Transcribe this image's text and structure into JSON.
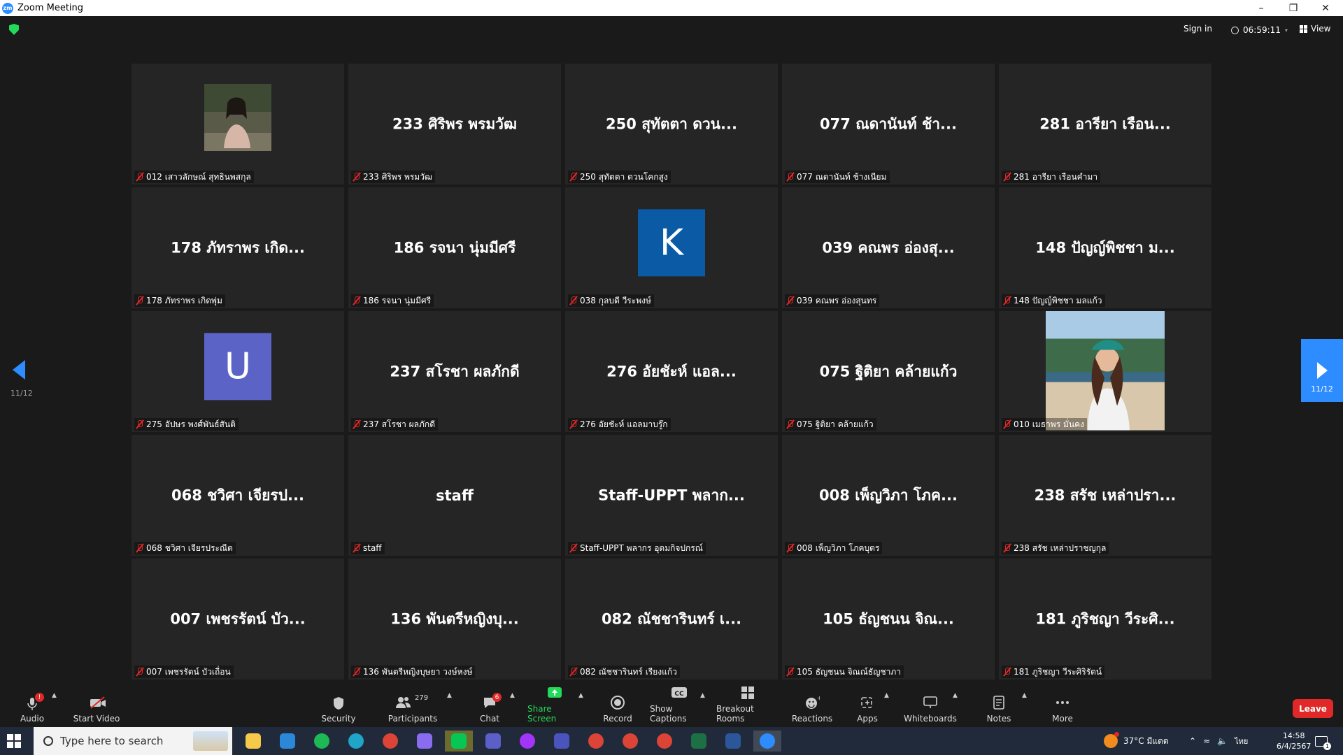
{
  "window": {
    "title": "Zoom Meeting",
    "logo": "zm"
  },
  "topbar": {
    "signin": "Sign in",
    "timer": "06:59:11",
    "view": "View"
  },
  "pager": {
    "left": "11/12",
    "right": "11/12"
  },
  "tiles": [
    {
      "big": "",
      "label": "012 เสาวลักษณ์ สุทธินพสกุล",
      "kind": "photo1"
    },
    {
      "big": "233 ศิริพร พรมวัฒ",
      "label": "233 ศิริพร พรมวัฒ"
    },
    {
      "big": "250 สุทัตตา ดวน...",
      "label": "250 สุทัตตา ดวนโคกสูง"
    },
    {
      "big": "077 ณดานันท์ ช้า...",
      "label": "077 ณดานันท์ ช้างเนียม"
    },
    {
      "big": "281 อารียา เรือน...",
      "label": "281 อารียา เรือนคำมา"
    },
    {
      "big": "178 ภัทราพร เกิด...",
      "label": "178 ภัทราพร เกิดพุ่ม"
    },
    {
      "big": "186 รจนา นุ่มมีศรี",
      "label": "186 รจนา นุ่มมีศรี"
    },
    {
      "big": "",
      "label": "038 กุลบดี วีระพงษ์",
      "kind": "avatar",
      "letter": "K",
      "color": "#0a5aa6"
    },
    {
      "big": "039 คณพร อ่องสุ...",
      "label": "039 คณพร อ่องสุนทร"
    },
    {
      "big": "148 ปัญญ์พิชชา ม...",
      "label": "148 ปัญญ์พิชชา มลแก้ว"
    },
    {
      "big": "",
      "label": "275 อัปษร พงศ์พันธ์สันติ",
      "kind": "avatar",
      "letter": "U",
      "color": "#5b63c7"
    },
    {
      "big": "237 สโรชา ผลภักดี",
      "label": "237 สโรชา ผลภักดี"
    },
    {
      "big": "276 อัยชัะห์ แอล...",
      "label": "276 อัยชัะห์ แอลมาบรู๊ก"
    },
    {
      "big": "075 ฐิติยา คล้ายแก้ว",
      "label": "075 ฐิติยา คล้ายแก้ว"
    },
    {
      "big": "",
      "label": "010 เมธาพร มั่นคง",
      "kind": "photo2"
    },
    {
      "big": "068 ชวิศา เจียรป...",
      "label": "068 ชวิศา เจียรประณีต"
    },
    {
      "big": "staff",
      "label": "staff"
    },
    {
      "big": "Staff-UPPT พลาก...",
      "label": "Staff-UPPT พลากร อุดมกิจปกรณ์"
    },
    {
      "big": "008 เพ็ญวิภา โภค...",
      "label": "008 เพ็ญวิภา โภคบุตร"
    },
    {
      "big": "238 สรัช เหล่าปรา...",
      "label": "238 สรัช เหล่าปราชญกุล"
    },
    {
      "big": "007 เพชรรัตน์ บัว...",
      "label": "007 เพชรรัตน์ บัวเถื่อน"
    },
    {
      "big": "136 พันตรีหญิงบุ...",
      "label": "136 พันตรีหญิงบุษยา วงษ์หงษ์"
    },
    {
      "big": "082 ณัชชารินทร์ เ...",
      "label": "082 ณัชชารินทร์ เรียงแก้ว"
    },
    {
      "big": "105 ธัญชนน จิณ...",
      "label": "105 ธัญชนน จิณณ์ธัญชาภา"
    },
    {
      "big": "181 ภูริชญา วีระศิ...",
      "label": "181 ภูริชญา วีระศิริรัตน์"
    }
  ],
  "toolbar": {
    "audio": "Audio",
    "start_video": "Start Video",
    "security": "Security",
    "participants": "Participants",
    "participants_count": "279",
    "chat": "Chat",
    "chat_badge": "6",
    "share_screen": "Share Screen",
    "record": "Record",
    "show_captions": "Show Captions",
    "breakout_rooms": "Breakout Rooms",
    "reactions": "Reactions",
    "apps": "Apps",
    "whiteboards": "Whiteboards",
    "notes": "Notes",
    "more": "More",
    "leave": "Leave",
    "audio_badge": "!"
  },
  "taskbar": {
    "search_placeholder": "Type here to search",
    "weather": "37°C มีแดด",
    "lang": "ไทย",
    "time": "14:58",
    "date": "6/4/2567",
    "apps": [
      "file-explorer-icon",
      "mail-icon",
      "spotify-icon",
      "edge-icon",
      "chrome-icon",
      "copilot-icon",
      "line-icon",
      "teams-icon",
      "messenger-icon",
      "teams-classic-icon",
      "chrome-icon",
      "chrome-icon",
      "chrome-icon",
      "excel-icon",
      "word-icon",
      "zoom-icon"
    ],
    "colors": {
      "accent": "#2d8cff",
      "leave": "#e02828",
      "share": "#23d959"
    }
  }
}
